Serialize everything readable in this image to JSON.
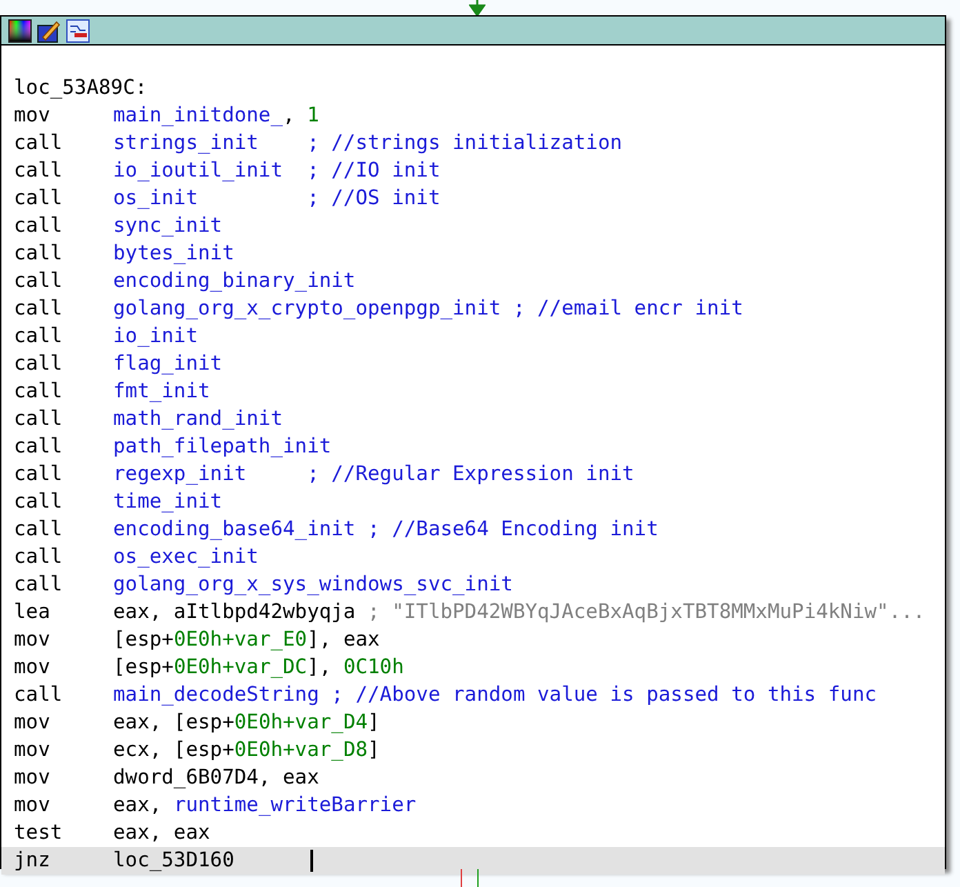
{
  "node": {
    "label": "loc_53A89C:",
    "lines": [
      {
        "mnemonic": "mov",
        "operands": [
          {
            "text": "main_initdone_",
            "kind": "name"
          },
          {
            "text": ", ",
            "kind": "plain"
          },
          {
            "text": "1",
            "kind": "number"
          }
        ],
        "selected": false
      },
      {
        "mnemonic": "call",
        "operands": [
          {
            "text": "strings_init    ; //strings initialization",
            "kind": "name"
          }
        ],
        "selected": false
      },
      {
        "mnemonic": "call",
        "operands": [
          {
            "text": "io_ioutil_init  ; //IO init",
            "kind": "name"
          }
        ],
        "selected": false
      },
      {
        "mnemonic": "call",
        "operands": [
          {
            "text": "os_init         ; //OS init",
            "kind": "name"
          }
        ],
        "selected": false
      },
      {
        "mnemonic": "call",
        "operands": [
          {
            "text": "sync_init",
            "kind": "name"
          }
        ],
        "selected": false
      },
      {
        "mnemonic": "call",
        "operands": [
          {
            "text": "bytes_init",
            "kind": "name"
          }
        ],
        "selected": false
      },
      {
        "mnemonic": "call",
        "operands": [
          {
            "text": "encoding_binary_init",
            "kind": "name"
          }
        ],
        "selected": false
      },
      {
        "mnemonic": "call",
        "operands": [
          {
            "text": "golang_org_x_crypto_openpgp_init ; //email encr init",
            "kind": "name"
          }
        ],
        "selected": false
      },
      {
        "mnemonic": "call",
        "operands": [
          {
            "text": "io_init",
            "kind": "name"
          }
        ],
        "selected": false
      },
      {
        "mnemonic": "call",
        "operands": [
          {
            "text": "flag_init",
            "kind": "name"
          }
        ],
        "selected": false
      },
      {
        "mnemonic": "call",
        "operands": [
          {
            "text": "fmt_init",
            "kind": "name"
          }
        ],
        "selected": false
      },
      {
        "mnemonic": "call",
        "operands": [
          {
            "text": "math_rand_init",
            "kind": "name"
          }
        ],
        "selected": false
      },
      {
        "mnemonic": "call",
        "operands": [
          {
            "text": "path_filepath_init",
            "kind": "name"
          }
        ],
        "selected": false
      },
      {
        "mnemonic": "call",
        "operands": [
          {
            "text": "regexp_init     ; //Regular Expression init",
            "kind": "name"
          }
        ],
        "selected": false
      },
      {
        "mnemonic": "call",
        "operands": [
          {
            "text": "time_init",
            "kind": "name"
          }
        ],
        "selected": false
      },
      {
        "mnemonic": "call",
        "operands": [
          {
            "text": "encoding_base64_init ; //Base64 Encoding init",
            "kind": "name"
          }
        ],
        "selected": false
      },
      {
        "mnemonic": "call",
        "operands": [
          {
            "text": "os_exec_init",
            "kind": "name"
          }
        ],
        "selected": false
      },
      {
        "mnemonic": "call",
        "operands": [
          {
            "text": "golang_org_x_sys_windows_svc_init",
            "kind": "name"
          }
        ],
        "selected": false
      },
      {
        "mnemonic": "lea",
        "operands": [
          {
            "text": "eax, aItlbpd42wbyqja ",
            "kind": "plain"
          },
          {
            "text": "; \"ITlbPD42WBYqJAceBxAqBjxTBT8MMxMuPi4kNiw\"...",
            "kind": "string"
          }
        ],
        "selected": false
      },
      {
        "mnemonic": "mov",
        "operands": [
          {
            "text": "[esp+",
            "kind": "plain"
          },
          {
            "text": "0E0h+var_E0",
            "kind": "number"
          },
          {
            "text": "], eax",
            "kind": "plain"
          }
        ],
        "selected": false
      },
      {
        "mnemonic": "mov",
        "operands": [
          {
            "text": "[esp+",
            "kind": "plain"
          },
          {
            "text": "0E0h+var_DC",
            "kind": "number"
          },
          {
            "text": "], ",
            "kind": "plain"
          },
          {
            "text": "0C10h",
            "kind": "number"
          }
        ],
        "selected": false
      },
      {
        "mnemonic": "call",
        "operands": [
          {
            "text": "main_decodeString ; //Above random value is passed to this func",
            "kind": "name"
          }
        ],
        "selected": false
      },
      {
        "mnemonic": "mov",
        "operands": [
          {
            "text": "eax, [esp+",
            "kind": "plain"
          },
          {
            "text": "0E0h+var_D4",
            "kind": "number"
          },
          {
            "text": "]",
            "kind": "plain"
          }
        ],
        "selected": false
      },
      {
        "mnemonic": "mov",
        "operands": [
          {
            "text": "ecx, [esp+",
            "kind": "plain"
          },
          {
            "text": "0E0h+var_D8",
            "kind": "number"
          },
          {
            "text": "]",
            "kind": "plain"
          }
        ],
        "selected": false
      },
      {
        "mnemonic": "mov",
        "operands": [
          {
            "text": "dword_6B07D4, eax",
            "kind": "plain"
          }
        ],
        "selected": false
      },
      {
        "mnemonic": "mov",
        "operands": [
          {
            "text": "eax, ",
            "kind": "plain"
          },
          {
            "text": "runtime_writeBarrier",
            "kind": "name"
          }
        ],
        "selected": false
      },
      {
        "mnemonic": "test",
        "operands": [
          {
            "text": "eax, eax",
            "kind": "plain"
          }
        ],
        "selected": false
      },
      {
        "mnemonic": "jnz",
        "operands": [
          {
            "text": "loc_53D160",
            "kind": "plain"
          }
        ],
        "selected": true
      }
    ]
  }
}
